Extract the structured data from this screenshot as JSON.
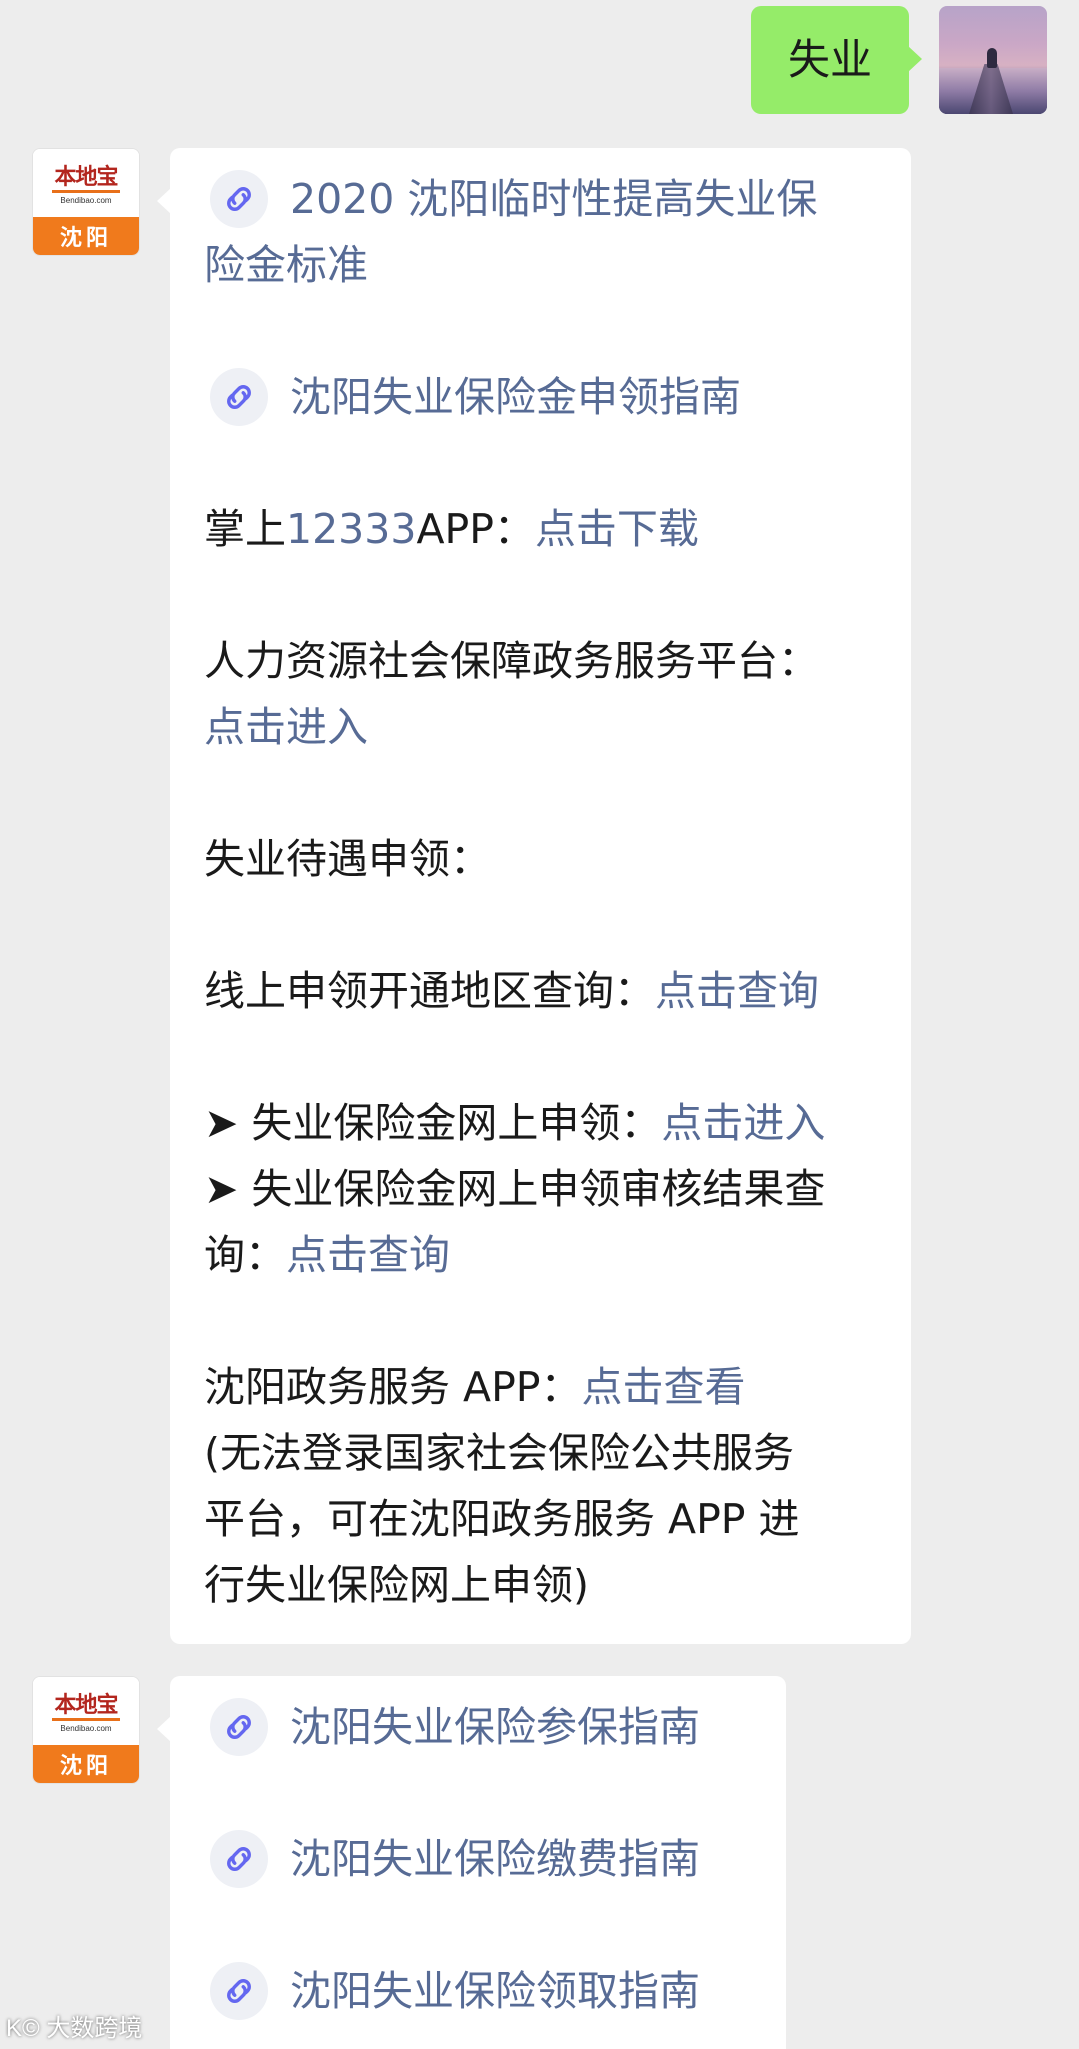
{
  "user_message": {
    "text": "失业"
  },
  "bot": {
    "logo_name": "本地宝",
    "logo_url": "Bendibao.com",
    "logo_city": "沈阳"
  },
  "message1": {
    "link1_line1": "2020 沈阳临时性提高失业保",
    "link1_line2": "险金标准",
    "link2": "沈阳失业保险金申领指南",
    "app_prefix": "掌上",
    "app_number": "12333",
    "app_suffix": "APP：",
    "app_link": "点击下载",
    "hr_platform": "人力资源社会保障政务服务平台：",
    "hr_link": "点击进入",
    "benefit_heading": "失业待遇申领：",
    "online_query": "线上申领开通地区查询：",
    "online_query_link": "点击查询",
    "item1": "➤ 失业保险金网上申领：",
    "item1_link": "点击进入",
    "item2_line1": "➤ 失业保险金网上申领审核结果查",
    "item2_line2": "询：",
    "item2_link": "点击查询",
    "gov_app": "沈阳政务服务 APP：",
    "gov_app_link": "点击查看",
    "note_line1": "(无法登录国家社会保险公共服务",
    "note_line2": "平台，可在沈阳政务服务 APP 进",
    "note_line3": "行失业保险网上申领)"
  },
  "message2": {
    "link1": "沈阳失业保险参保指南",
    "link2": "沈阳失业保险缴费指南",
    "link3": "沈阳失业保险领取指南"
  },
  "watermark": "K© 大数跨境",
  "colors": {
    "link": "#576b95",
    "my_bubble": "#95ec69",
    "background": "#ededed"
  }
}
